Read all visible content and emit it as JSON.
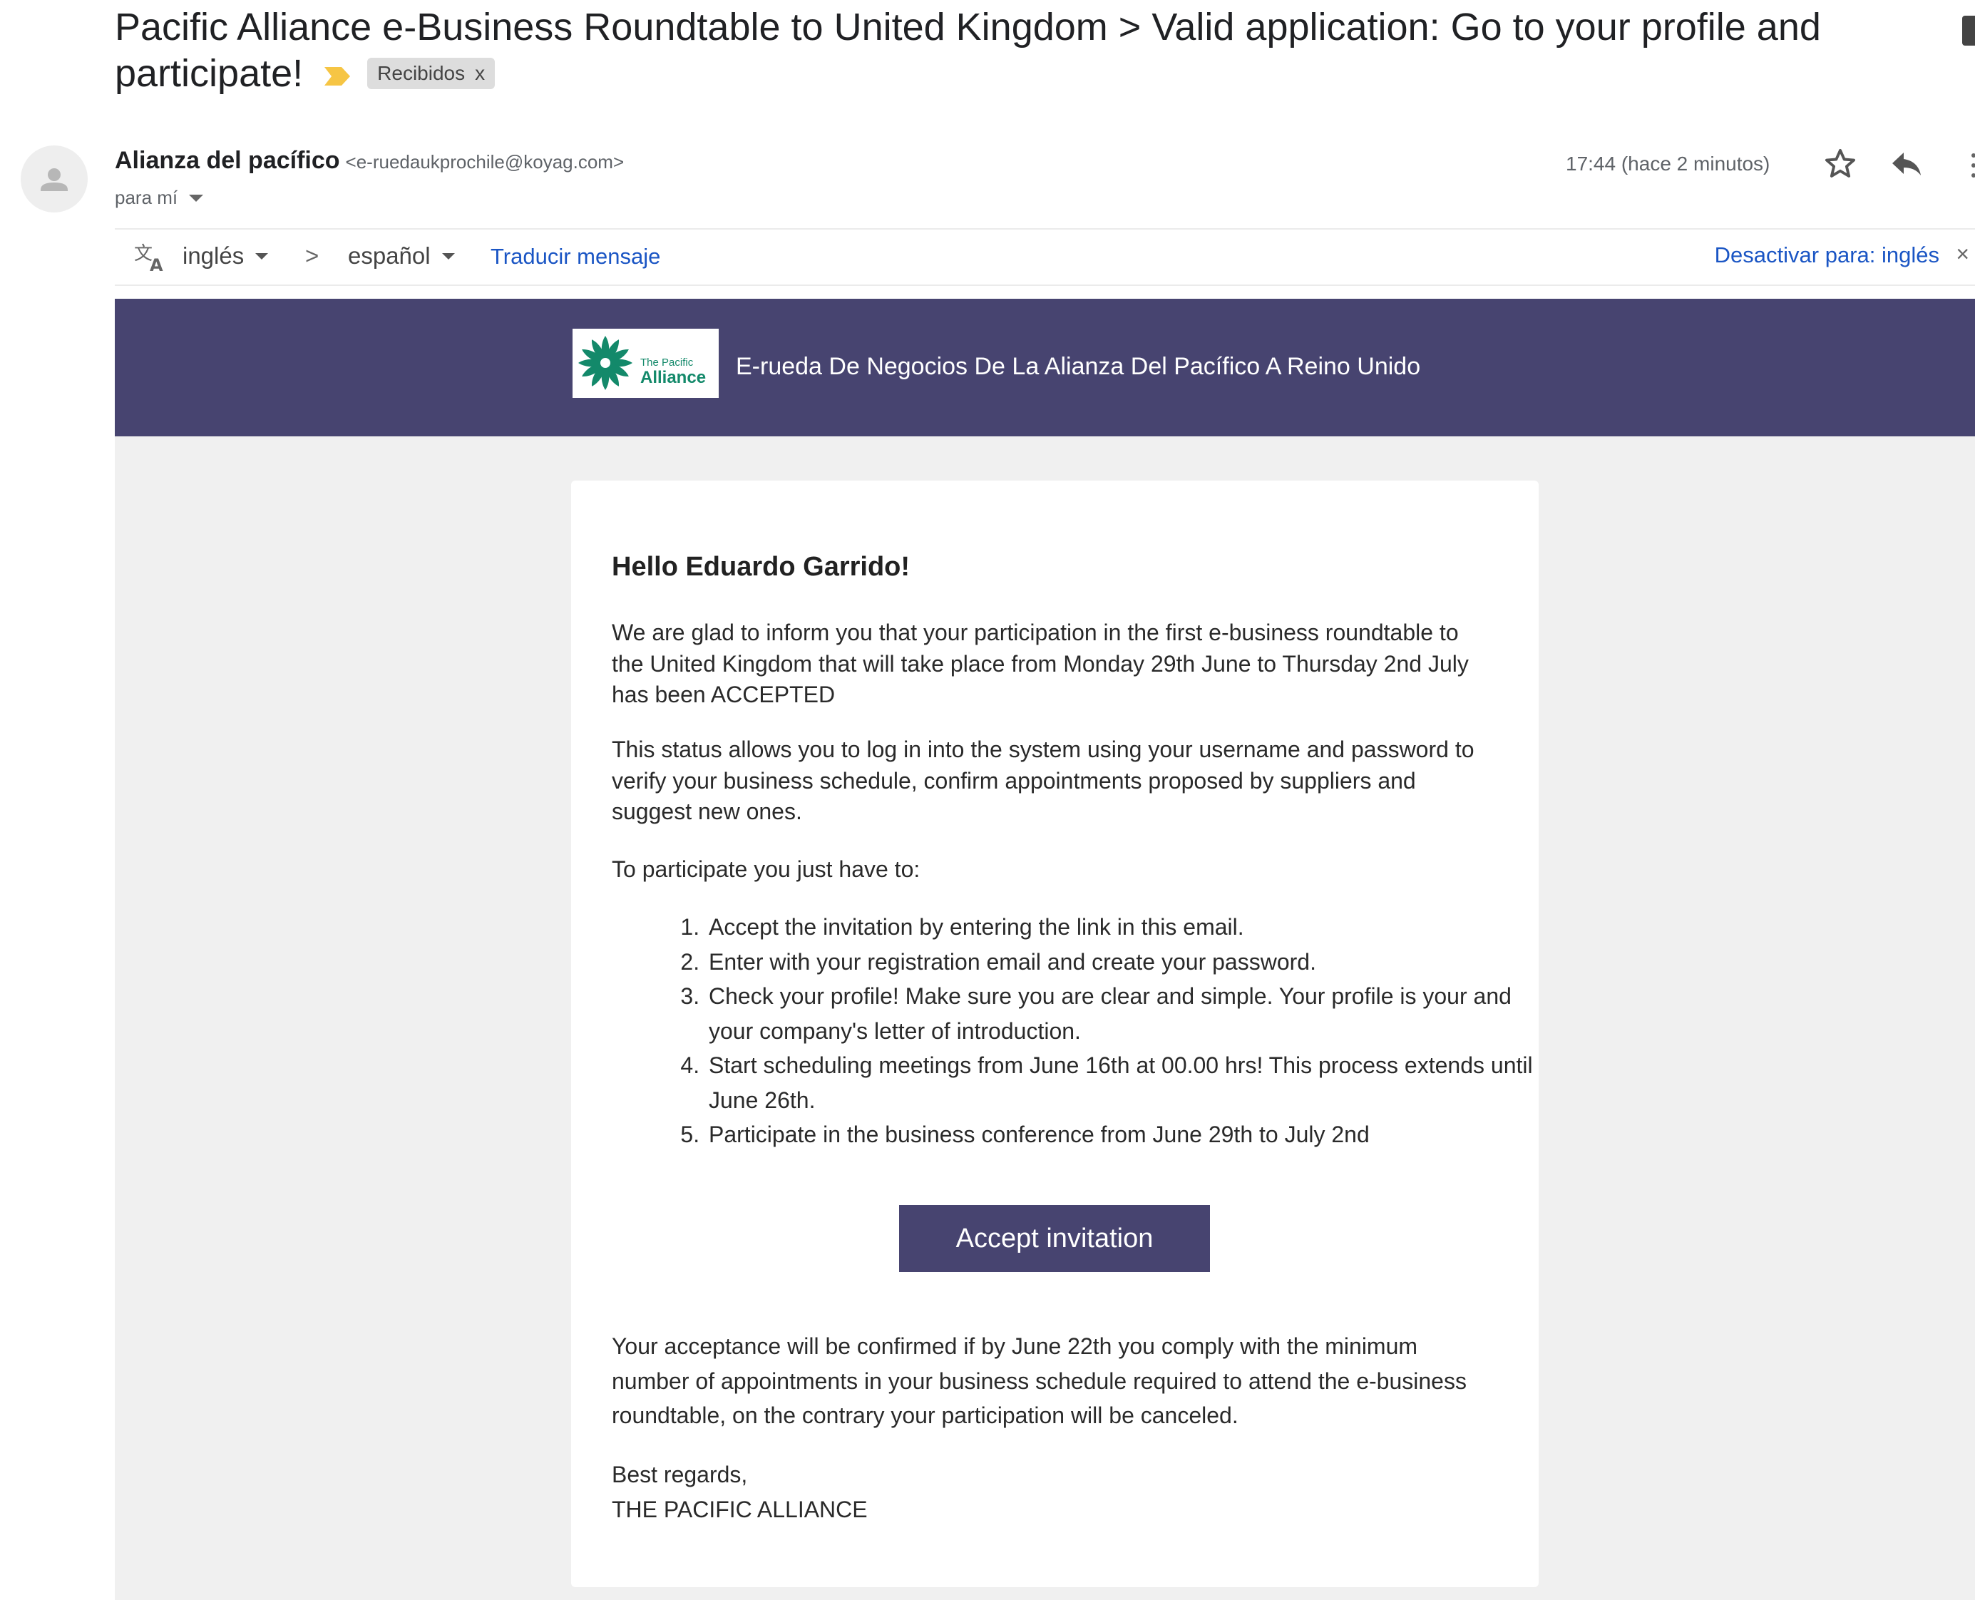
{
  "subject": {
    "title": "Pacific Alliance e-Business Roundtable to United Kingdom > Valid application: Go to your profile and participate!",
    "label_chip": "Recibidos",
    "label_chip_close": "x"
  },
  "sender": {
    "name": "Alianza del pacífico",
    "email": "<e-ruedaukprochile@koyag.com>",
    "to": "para mí",
    "time": "17:44 (hace 2 minutos)"
  },
  "translate_bar": {
    "source_lang": "inglés",
    "separator": ">",
    "target_lang": "español",
    "translate_link": "Traducir mensaje",
    "disable_link": "Desactivar para: inglés",
    "close": "×"
  },
  "email": {
    "banner_title": "E-rueda De Negocios De La Alianza Del Pacífico A Reino Unido",
    "logo_text_top": "The Pacific",
    "logo_text_bottom": "Alliance",
    "greeting": "Hello Eduardo Garrido!",
    "paragraph1": "We are glad to inform you that your participation in the first e-business roundtable to the United Kingdom that will take place from Monday 29th June to Thursday 2nd July has been ACCEPTED",
    "paragraph2": "This status allows you to log in into the system using your username and password to verify your business schedule, confirm appointments proposed by suppliers and suggest new ones.",
    "paragraph3": "To participate you just have to:",
    "steps": [
      "Accept the invitation by entering the link in this email.",
      "Enter with your registration email and create your password.",
      "Check your profile! Make sure you are clear and simple. Your profile is your and your company's letter of introduction.",
      "Start scheduling meetings from June 16th at 00.00 hrs! This process extends until June 26th.",
      "Participate in the business conference from June 29th to July 2nd"
    ],
    "accept_button": "Accept invitation",
    "paragraph4": "Your acceptance will be confirmed if by June 22th you comply with the minimum number of appointments in your business schedule required to attend the e-business roundtable, on the contrary your participation will be canceled.",
    "closing": "Best regards,",
    "signature": "THE PACIFIC ALLIANCE"
  },
  "colors": {
    "banner": "#474470",
    "button": "#474470",
    "link": "#1a55c4",
    "label_arrow": "#f6c544"
  },
  "icons": [
    "label-arrow-icon",
    "print-icon",
    "person-icon",
    "star-icon",
    "reply-icon",
    "more-icon",
    "translate-icon",
    "pacific-alliance-logo"
  ]
}
